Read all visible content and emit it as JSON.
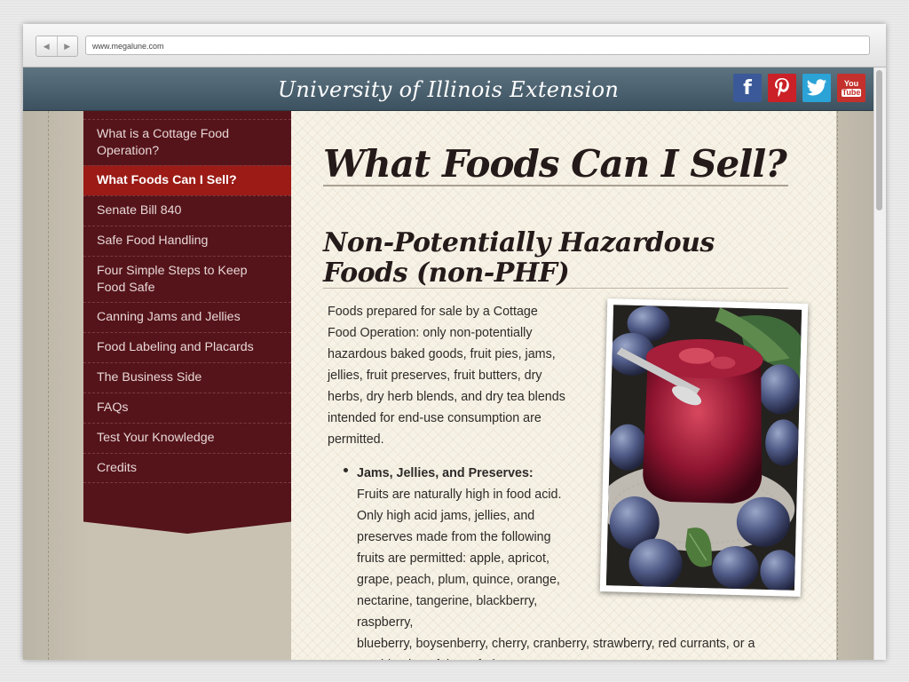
{
  "browser": {
    "url": "www.megalune.com",
    "back_icon": "◀",
    "forward_icon": "▶"
  },
  "header": {
    "title": "University of Illinois Extension",
    "social": [
      {
        "name": "facebook",
        "glyph": "f"
      },
      {
        "name": "pinterest",
        "glyph": "P"
      },
      {
        "name": "twitter",
        "glyph": "t"
      },
      {
        "name": "youtube",
        "glyph_top": "You",
        "glyph_bottom": "Tube"
      }
    ]
  },
  "sidebar": {
    "items": [
      {
        "label": "What is a Cottage Food Operation?"
      },
      {
        "label": "What Foods Can I Sell?",
        "active": true
      },
      {
        "label": "Senate Bill 840"
      },
      {
        "label": "Safe Food Handling"
      },
      {
        "label": "Four Simple Steps to Keep Food Safe"
      },
      {
        "label": "Canning Jams and Jellies"
      },
      {
        "label": "Food Labeling and Placards"
      },
      {
        "label": "The Business Side"
      },
      {
        "label": "FAQs"
      },
      {
        "label": "Test Your Knowledge"
      },
      {
        "label": "Credits"
      }
    ]
  },
  "main": {
    "title": "What Foods Can I Sell?",
    "section_title": "Non-Potentially Hazardous Foods (non-PHF)",
    "intro": "Foods prepared for sale by a Cottage Food Operation: only non-potentially hazardous baked goods, fruit pies, jams, jellies, fruit preserves, fruit butters, dry herbs, dry herb blends, and dry tea blends intended for end-use consumption are permitted.",
    "bullet": {
      "label": "Jams, Jellies, and Preserves:",
      "text_narrow": "Fruits are naturally high in food acid. Only high acid jams, jellies, and preserves made from the following fruits are permitted: apple, apricot, grape, peach, plum, quince, orange, nectarine, tangerine, blackberry, raspberry,",
      "text_wide": "blueberry, boysenberry, cherry, cranberry, strawberry, red currants, or a combination of those fruits."
    }
  },
  "colors": {
    "header": "#4a5f6c",
    "sidebar": "#55141a",
    "sidebar_active": "#9c1b16",
    "content_bg": "#f7f2e6"
  }
}
